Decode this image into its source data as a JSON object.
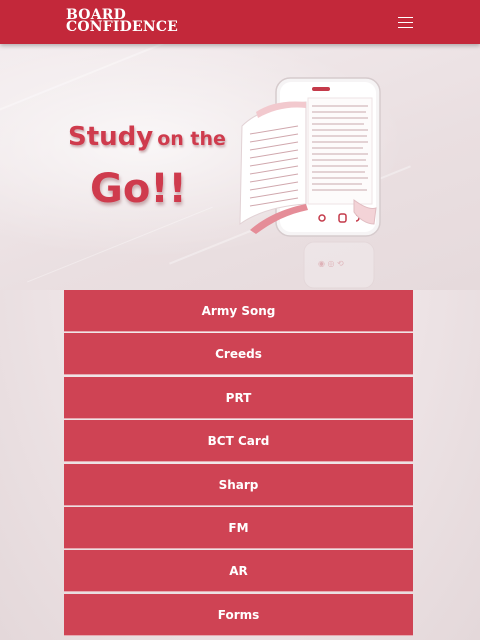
{
  "header": {
    "logo_line1": "BOARD",
    "logo_line2": "CONFIDENCE",
    "menu_icon": "hamburger-icon"
  },
  "hero": {
    "headline_study": "Study",
    "headline_onthe": "on the",
    "headline_go": "Go!!",
    "illustration": "phone-book-illustration"
  },
  "menu": {
    "items": [
      {
        "label": "Army Song"
      },
      {
        "label": "Creeds"
      },
      {
        "label": "PRT"
      },
      {
        "label": "BCT Card"
      },
      {
        "label": "Sharp"
      },
      {
        "label": "FM"
      },
      {
        "label": "AR"
      },
      {
        "label": "Forms"
      }
    ]
  },
  "colors": {
    "topbar": "#c3283a",
    "accent": "#cf4354",
    "headline": "#cf3b4d"
  }
}
